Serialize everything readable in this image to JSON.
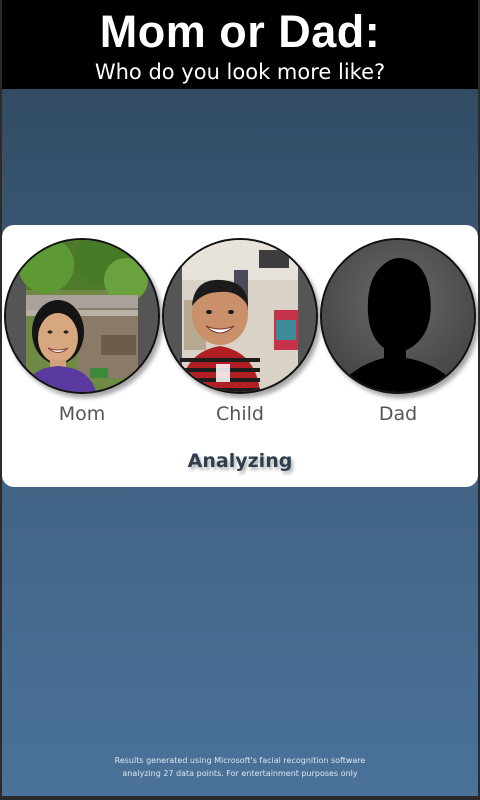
{
  "header": {
    "title": "Mom or Dad:",
    "subtitle": "Who do you look more like?"
  },
  "people": {
    "mom": {
      "label": "Mom",
      "image": "mom-photo"
    },
    "child": {
      "label": "Child",
      "image": "child-photo"
    },
    "dad": {
      "label": "Dad",
      "image": "silhouette-placeholder"
    }
  },
  "status": "Analyzing",
  "footer": {
    "line1": "Results generated using Microsoft's facial recognition software",
    "line2": "analyzing 27 data points. For entertainment purposes only"
  },
  "colors": {
    "header_bg": "#000000",
    "card_bg": "#ffffff",
    "background_top": "#2c4459",
    "background_bottom": "#4a729a",
    "status_text": "#2f3e4e"
  }
}
